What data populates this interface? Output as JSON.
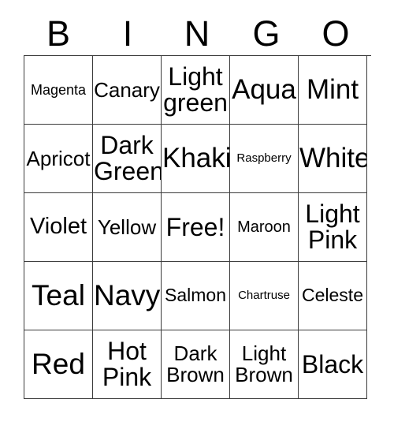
{
  "card": {
    "header": {
      "letters": [
        {
          "label": "B"
        },
        {
          "label": "I"
        },
        {
          "label": "N"
        },
        {
          "label": "G"
        },
        {
          "label": "O"
        }
      ]
    },
    "free_space": "Free!",
    "colors": {
      "border": "#3b3b3b",
      "text": "#000000",
      "background": "#ffffff"
    },
    "rows": [
      {
        "cells": [
          {
            "label": "Magenta",
            "size": "s"
          },
          {
            "label": "Canary",
            "size": "ml"
          },
          {
            "label": "Light\ngreen",
            "size": "xl"
          },
          {
            "label": "Aqua",
            "size": "xxl"
          },
          {
            "label": "Mint",
            "size": "xxl"
          }
        ]
      },
      {
        "cells": [
          {
            "label": "Apricot",
            "size": "ml"
          },
          {
            "label": "Dark\nGreen",
            "size": "xl"
          },
          {
            "label": "Khaki",
            "size": "xxl"
          },
          {
            "label": "Raspberry",
            "size": "xs"
          },
          {
            "label": "White",
            "size": "xxl"
          }
        ]
      },
      {
        "cells": [
          {
            "label": "Violet",
            "size": "l"
          },
          {
            "label": "Yellow",
            "size": "ml"
          },
          {
            "label": "Free!",
            "size": "xl"
          },
          {
            "label": "Maroon",
            "size": "sm"
          },
          {
            "label": "Light\nPink",
            "size": "xl"
          }
        ]
      },
      {
        "cells": [
          {
            "label": "Teal",
            "size": "max"
          },
          {
            "label": "Navy",
            "size": "max"
          },
          {
            "label": "Salmon",
            "size": "m"
          },
          {
            "label": "Chartruse",
            "size": "xs"
          },
          {
            "label": "Celeste",
            "size": "m"
          }
        ]
      },
      {
        "cells": [
          {
            "label": "Red",
            "size": "max"
          },
          {
            "label": "Hot\nPink",
            "size": "xl"
          },
          {
            "label": "Dark\nBrown",
            "size": "ml"
          },
          {
            "label": "Light\nBrown",
            "size": "ml"
          },
          {
            "label": "Black",
            "size": "xl"
          }
        ]
      }
    ]
  }
}
